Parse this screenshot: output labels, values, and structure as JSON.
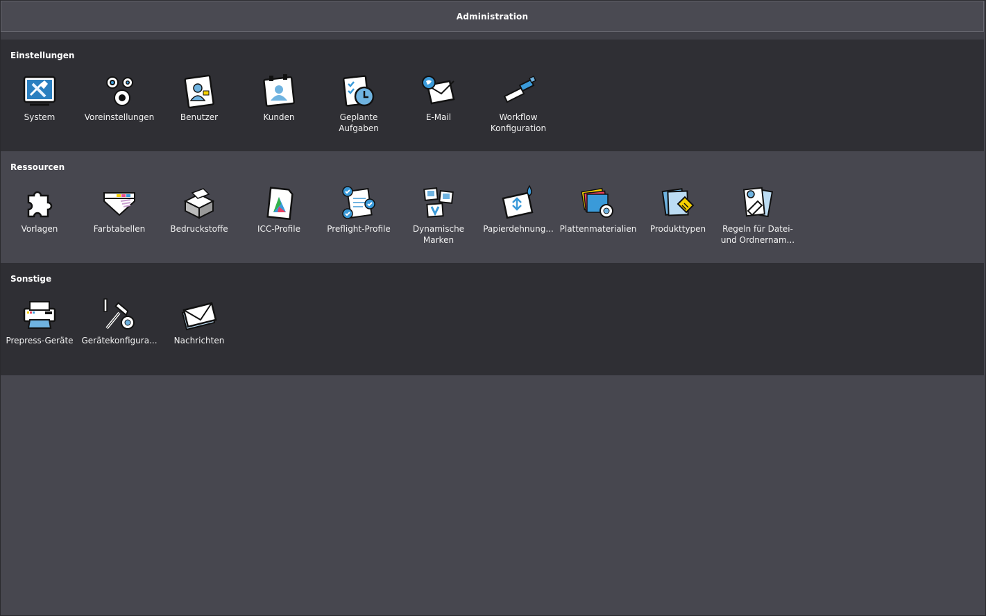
{
  "window": {
    "title": "Administration"
  },
  "sections": [
    {
      "title": "Einstellungen",
      "items": [
        {
          "label": "System",
          "icon": "system-icon"
        },
        {
          "label": "Voreinstellungen",
          "icon": "gears-icon"
        },
        {
          "label": "Benutzer",
          "icon": "user-icon"
        },
        {
          "label": "Kunden",
          "icon": "customers-icon"
        },
        {
          "label": "Geplante\nAufgaben",
          "icon": "scheduled-tasks-icon"
        },
        {
          "label": "E-Mail",
          "icon": "email-icon"
        },
        {
          "label": "Workflow\nKonfiguration",
          "icon": "workflow-icon"
        }
      ]
    },
    {
      "title": "Ressourcen",
      "items": [
        {
          "label": "Vorlagen",
          "icon": "puzzle-icon"
        },
        {
          "label": "Farbtabellen",
          "icon": "color-swatch-icon"
        },
        {
          "label": "Bedruckstoffe",
          "icon": "paper-box-icon"
        },
        {
          "label": "ICC-Profile",
          "icon": "icc-profile-icon"
        },
        {
          "label": "Preflight-Profile",
          "icon": "preflight-icon"
        },
        {
          "label": "Dynamische\nMarken",
          "icon": "dynamic-marks-icon"
        },
        {
          "label": "Papierdehnung...",
          "icon": "paper-stretch-icon"
        },
        {
          "label": "Plattenmaterialien",
          "icon": "plate-materials-icon"
        },
        {
          "label": "Produkttypen",
          "icon": "product-types-icon"
        },
        {
          "label": "Regeln für Datei-\nund Ordnernam...",
          "icon": "naming-rules-icon"
        }
      ]
    },
    {
      "title": "Sonstige",
      "items": [
        {
          "label": "Prepress-Geräte",
          "icon": "printer-icon"
        },
        {
          "label": "Gerätekonfigura...",
          "icon": "device-config-icon"
        },
        {
          "label": "Nachrichten",
          "icon": "messages-icon"
        }
      ]
    }
  ],
  "colors": {
    "accent": "#3a9ad9",
    "dark_section": "#2f2f34",
    "light_section": "#47474f"
  }
}
